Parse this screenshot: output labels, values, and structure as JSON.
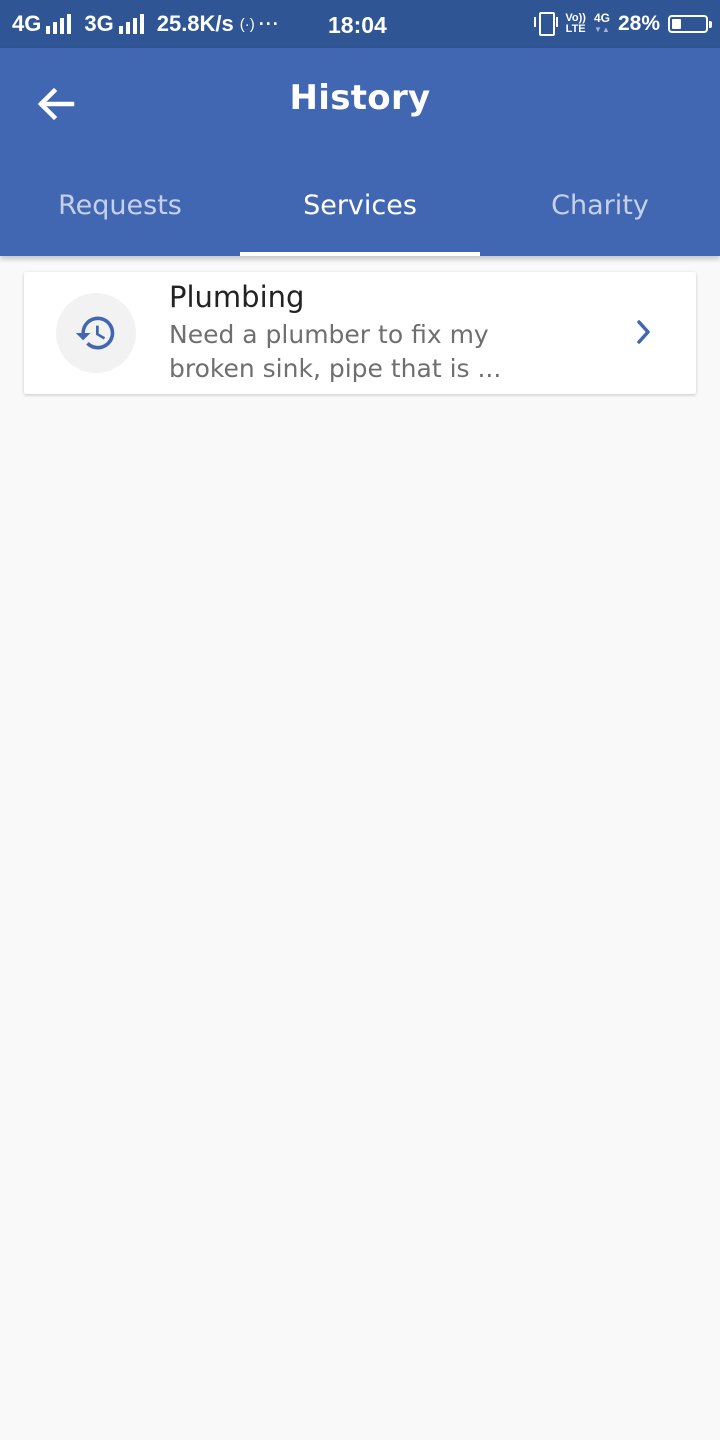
{
  "status_bar": {
    "network_1": "4G",
    "network_2": "3G",
    "speed": "25.8K/s",
    "hotspot": "(·)",
    "more": "···",
    "time": "18:04",
    "volte_top": "Vo))",
    "volte_bottom": "LTE",
    "net_type": "4G",
    "net_arrows": "▼▲",
    "battery_percent": "28%",
    "battery_level": 0.28
  },
  "app_bar": {
    "title": "History",
    "back_icon": "arrow-back-icon",
    "color": "#4267b2"
  },
  "tabs": [
    {
      "label": "Requests",
      "active": false
    },
    {
      "label": "Services",
      "active": true
    },
    {
      "label": "Charity",
      "active": false
    }
  ],
  "history_items": [
    {
      "title": "Plumbing",
      "description": "Need a plumber to fix my broken sink, pipe that is ...",
      "icon": "history-icon",
      "action_icon": "chevron-right-icon"
    }
  ],
  "colors": {
    "status_bar": "#2f5594",
    "primary": "#4267b2",
    "background": "#f9f9f9",
    "accent_icon": "#4267b2"
  }
}
